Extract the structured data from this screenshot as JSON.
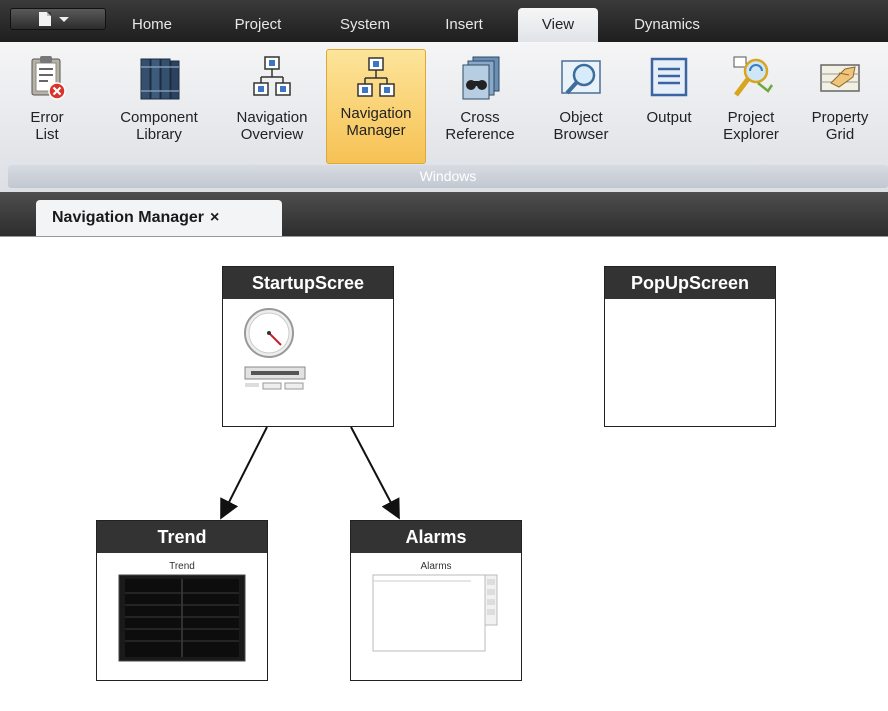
{
  "menu": {
    "tabs": [
      "Home",
      "Project",
      "System",
      "Insert",
      "View",
      "Dynamics"
    ],
    "active_tab": "View"
  },
  "ribbon": {
    "buttons": [
      {
        "label": "Error\nList",
        "icon": "error-list-icon"
      },
      {
        "label": "Component\nLibrary",
        "icon": "component-library-icon"
      },
      {
        "label": "Navigation\nOverview",
        "icon": "navigation-overview-icon"
      },
      {
        "label": "Navigation\nManager",
        "icon": "navigation-manager-icon"
      },
      {
        "label": "Cross\nReference",
        "icon": "cross-reference-icon"
      },
      {
        "label": "Object\nBrowser",
        "icon": "object-browser-icon"
      },
      {
        "label": "Output",
        "icon": "output-icon"
      },
      {
        "label": "Project\nExplorer",
        "icon": "project-explorer-icon"
      },
      {
        "label": "Property\nGrid",
        "icon": "property-grid-icon"
      }
    ],
    "selected_button": "Navigation\nManager",
    "group_label": "Windows"
  },
  "document_tab": {
    "title": "Navigation Manager",
    "close_glyph": "×"
  },
  "screens": {
    "startup": {
      "title": "StartupScree"
    },
    "popup": {
      "title": "PopUpScreen"
    },
    "trend": {
      "title": "Trend",
      "thumb_label": "Trend"
    },
    "alarms": {
      "title": "Alarms",
      "thumb_label": "Alarms"
    }
  },
  "colors": {
    "selected_highlight": "#f6c254",
    "node_header": "#333333",
    "tab_bar": "#2c2c2c"
  }
}
